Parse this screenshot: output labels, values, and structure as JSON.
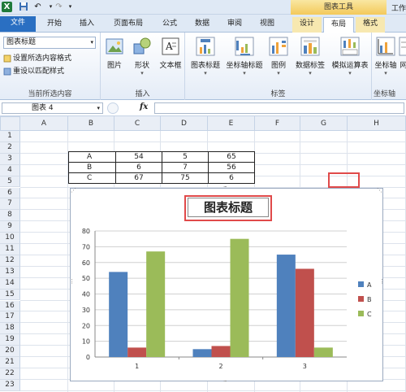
{
  "app": {
    "window_title": "工作",
    "tool_group_label": "图表工具",
    "quick_access": [
      "excel-logo",
      "save-icon",
      "undo-icon",
      "redo-icon"
    ]
  },
  "tabs": [
    {
      "label": "文件",
      "style": "file"
    },
    {
      "label": "开始"
    },
    {
      "label": "插入"
    },
    {
      "label": "页面布局"
    },
    {
      "label": "公式"
    },
    {
      "label": "数据"
    },
    {
      "label": "审阅"
    },
    {
      "label": "视图"
    },
    {
      "label": "设计",
      "style": "context"
    },
    {
      "label": "布局",
      "style": "context-active"
    },
    {
      "label": "格式",
      "style": "context"
    }
  ],
  "ribbon": {
    "current_selection": {
      "dropdown_value": "图表标题",
      "format_selection": "设置所选内容格式",
      "reset_style": "重设以匹配样式",
      "group_label": "当前所选内容"
    },
    "insert": {
      "picture": "图片",
      "shapes": "形状",
      "textbox": "文本框",
      "group_label": "插入"
    },
    "labels": {
      "chart_title": "图表标题",
      "axis_titles": "坐标轴标题",
      "legend": "图例",
      "data_labels": "数据标签",
      "data_table": "模拟运算表",
      "group_label": "标签"
    },
    "axes": {
      "axes": "坐标轴",
      "gridlines_partial": "网",
      "group_label": "坐标轴"
    }
  },
  "formula_bar": {
    "name_box": "图表 4",
    "fx": "fx",
    "formula": ""
  },
  "sheet": {
    "columns": [
      "A",
      "B",
      "C",
      "D",
      "E",
      "F",
      "G",
      "H"
    ],
    "rows": [
      "1",
      "2",
      "3",
      "4",
      "5",
      "6",
      "7",
      "8",
      "9",
      "10",
      "11",
      "12",
      "13",
      "14",
      "15",
      "16",
      "17",
      "18",
      "19",
      "20",
      "21",
      "22",
      "23"
    ],
    "table": [
      {
        "label": "A",
        "values": [
          "54",
          "5",
          "65"
        ]
      },
      {
        "label": "B",
        "values": [
          "6",
          "7",
          "56"
        ]
      },
      {
        "label": "C",
        "values": [
          "67",
          "75",
          "6"
        ]
      }
    ]
  },
  "chart_data": {
    "type": "bar",
    "title": "图表标题",
    "categories": [
      "1",
      "2",
      "3"
    ],
    "series": [
      {
        "name": "A",
        "values": [
          54,
          5,
          65
        ],
        "color": "#4f81bd"
      },
      {
        "name": "B",
        "values": [
          6,
          7,
          56
        ],
        "color": "#c0504d"
      },
      {
        "name": "C",
        "values": [
          67,
          75,
          6
        ],
        "color": "#9bbb59"
      }
    ],
    "ylim": [
      0,
      80
    ],
    "yticks": [
      "0",
      "10",
      "20",
      "30",
      "40",
      "50",
      "60",
      "70",
      "80"
    ],
    "grid": true,
    "legend_position": "right"
  }
}
